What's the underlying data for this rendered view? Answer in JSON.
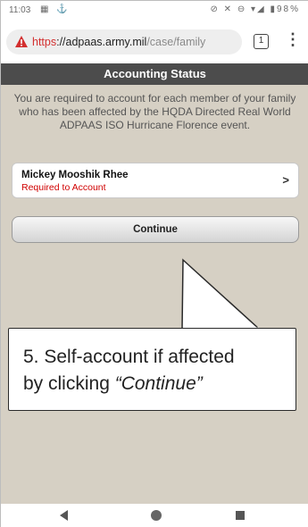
{
  "status_bar": {
    "time": "11:03",
    "left_icons": "▦ ⚓",
    "right_icons": "⊘ ✕ ⊖ ▾◢ ▮98%"
  },
  "browser": {
    "url_https": "https",
    "url_host": "://adpaas.army.mil",
    "url_path": "/case/family",
    "tab_count": "1",
    "menu_icon": "⋮"
  },
  "app": {
    "header_title": "Accounting Status",
    "intro_text": "You are required to account for each member of your family who has been affected by the HQDA Directed Real World ADPAAS ISO Hurricane Florence event.",
    "members": [
      {
        "name": "Mickey Mooshik Rhee",
        "status": "Required to Account"
      }
    ],
    "chevron": ">",
    "continue_label": "Continue"
  },
  "callout": {
    "line1": "5. Self-account if affected",
    "line2_prefix": "by clicking ",
    "line2_emphasis": "“Continue”"
  },
  "colors": {
    "app_background": "#d6d0c4",
    "header_background": "#4c4c4c",
    "warning_red": "#d32f2f",
    "status_red": "#d00000"
  }
}
